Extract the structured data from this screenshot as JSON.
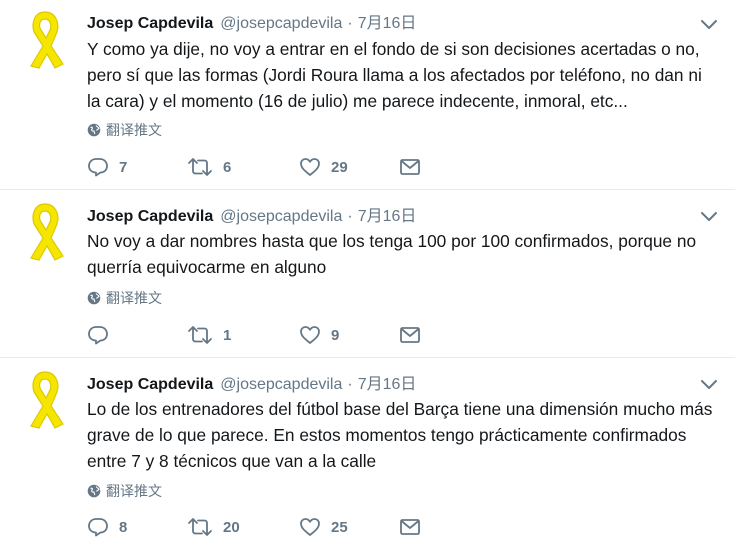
{
  "tweets": [
    {
      "name": "Josep Capdevila",
      "handle": "@josepcapdevila",
      "separator": "·",
      "time": "7月16日",
      "lines": [
        "Y como ya dije, no voy a entrar en el fondo de si son decisiones acertadas o no,",
        "pero sí que las formas (Jordi Roura llama a los afectados por teléfono, no dan ni",
        "la cara) y el momento (16 de julio) me parece indecente, inmoral, etc..."
      ],
      "translate_label": "翻译推文",
      "replies": "7",
      "retweets": "6",
      "likes": "29"
    },
    {
      "name": "Josep Capdevila",
      "handle": "@josepcapdevila",
      "separator": "·",
      "time": "7月16日",
      "lines": [
        "No voy a dar nombres hasta que los tenga 100 por 100 confirmados, porque no",
        "querría equivocarme en alguno"
      ],
      "translate_label": "翻译推文",
      "replies": "",
      "retweets": "1",
      "likes": "9"
    },
    {
      "name": "Josep Capdevila",
      "handle": "@josepcapdevila",
      "separator": "·",
      "time": "7月16日",
      "lines": [
        "Lo de los entrenadores del fútbol base del Barça tiene una dimensión mucho más",
        "grave de lo que parece. En estos momentos tengo prácticamente confirmados",
        "entre 7 y 8 técnicos que van a la calle"
      ],
      "translate_label": "翻译推文",
      "replies": "8",
      "retweets": "20",
      "likes": "25"
    }
  ],
  "icons": {
    "avatar": "yellow-ribbon-icon",
    "caret": "chevron-down-icon",
    "translate": "globe-icon",
    "reply": "reply-icon",
    "retweet": "retweet-icon",
    "like": "heart-icon",
    "dm": "envelope-icon"
  },
  "colors": {
    "ribbon": "#f5e600",
    "ribbon_outline": "#e0c800",
    "muted": "#657786",
    "divider": "#e6ecf0"
  }
}
